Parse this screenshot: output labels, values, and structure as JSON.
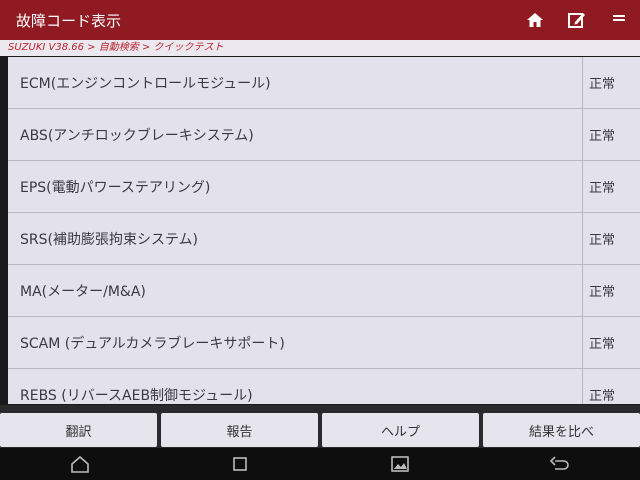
{
  "header": {
    "title": "故障コード表示",
    "icons": [
      "home-icon",
      "edit-icon",
      "more-icon"
    ]
  },
  "breadcrumb": "SUZUKI V38.66 > 自動検索 > クイックテスト",
  "systems": [
    {
      "name": "ECM(エンジンコントロールモジュール)",
      "status": "正常"
    },
    {
      "name": "ABS(アンチロックブレーキシステム)",
      "status": "正常"
    },
    {
      "name": "EPS(電動パワーステアリング)",
      "status": "正常"
    },
    {
      "name": "SRS(補助膨張拘束システム)",
      "status": "正常"
    },
    {
      "name": "MA(メーター/M&A)",
      "status": "正常"
    },
    {
      "name": "SCAM (デュアルカメラブレーキサポート)",
      "status": "正常"
    },
    {
      "name": "REBS (リバースAEB制御モジュール)",
      "status": "正常"
    }
  ],
  "buttons": {
    "translate": "翻訳",
    "report": "報告",
    "help": "ヘルプ",
    "compare": "結果を比べ"
  },
  "navbar": [
    "home-nav-icon",
    "recent-apps-icon",
    "screenshot-icon",
    "back-icon"
  ]
}
